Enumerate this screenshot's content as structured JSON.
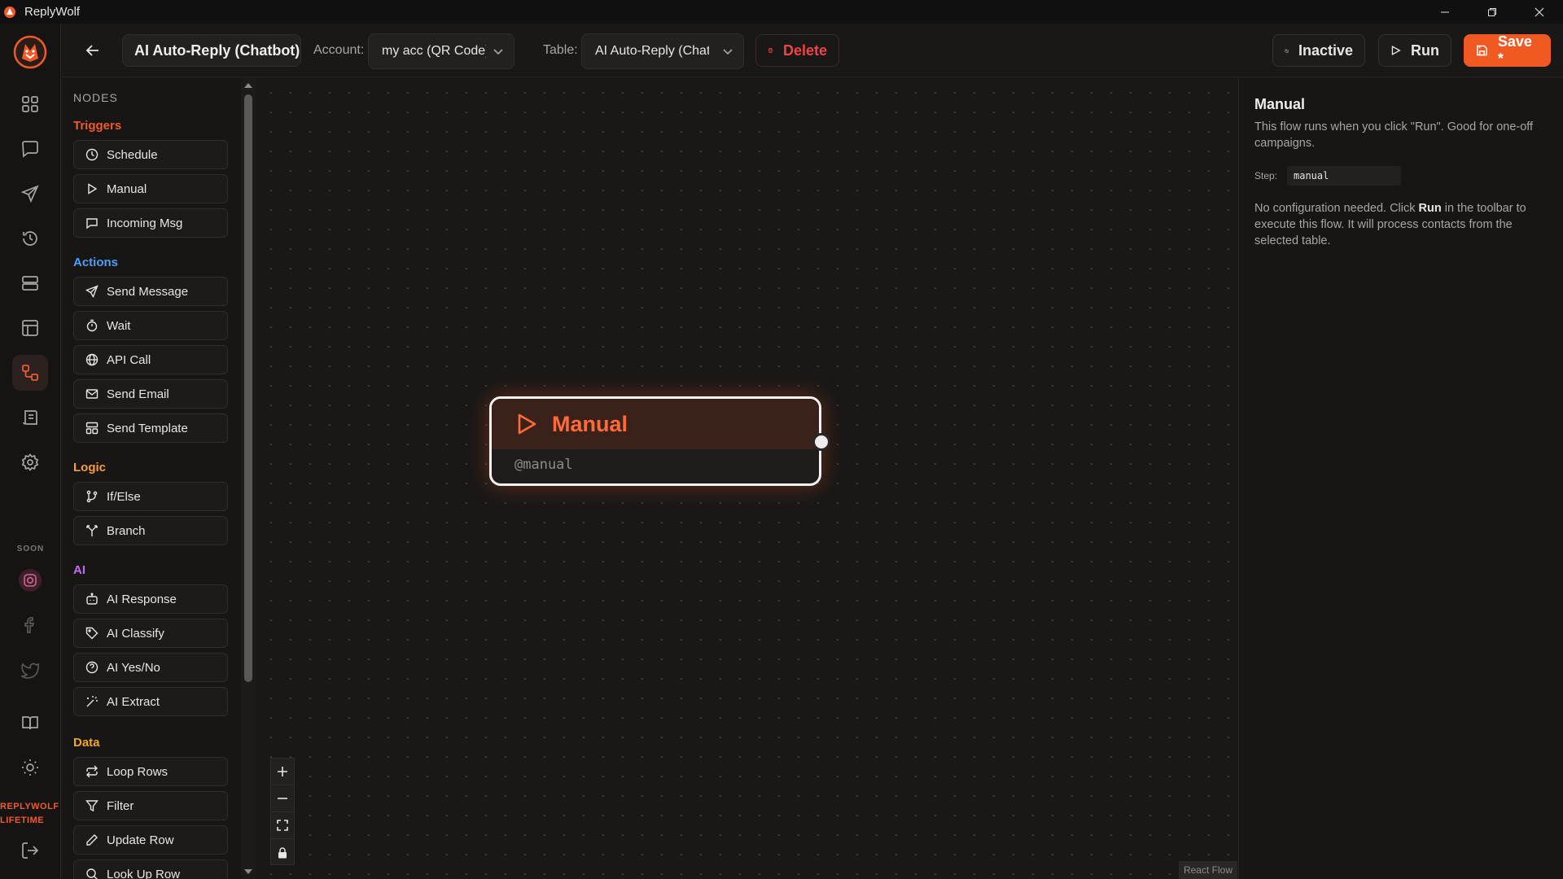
{
  "window": {
    "title": "ReplyWolf",
    "controls": [
      "minimize-icon",
      "restore-icon",
      "close-icon"
    ]
  },
  "rail": {
    "items": [
      "dashboard-icon",
      "chat-icon",
      "send-icon",
      "history-icon",
      "tables-icon",
      "layout-icon",
      "flows-icon",
      "templates-icon",
      "settings-icon"
    ],
    "active": "flows-icon",
    "soon_label": "SOON",
    "soon_items": [
      "instagram-icon",
      "facebook-icon",
      "twitter-icon"
    ],
    "bottom_items": [
      "docs-icon",
      "theme-icon",
      "logout-icon"
    ],
    "plan_line1": "REPLYWOLF",
    "plan_line2": "LIFETIME"
  },
  "toolbar": {
    "flow_name": "AI Auto-Reply (Chatbot)",
    "account_label": "Account:",
    "account_value": "my acc (QR Code)",
    "table_label": "Table:",
    "table_value": "AI Auto-Reply (Chatbot)",
    "delete_label": "Delete",
    "inactive_label": "Inactive",
    "run_label": "Run",
    "save_label": "Save *"
  },
  "palette": {
    "title": "NODES",
    "sections": {
      "triggers": {
        "label": "Triggers",
        "color": "#ef5a2a",
        "items": [
          "Schedule",
          "Manual",
          "Incoming Msg"
        ]
      },
      "actions": {
        "label": "Actions",
        "color": "#4f9df5",
        "items": [
          "Send Message",
          "Wait",
          "API Call",
          "Send Email",
          "Send Template"
        ]
      },
      "logic": {
        "label": "Logic",
        "color": "#f59e3b",
        "items": [
          "If/Else",
          "Branch"
        ]
      },
      "ai": {
        "label": "AI",
        "color": "#c06cf0",
        "items": [
          "AI Response",
          "AI Classify",
          "AI Yes/No",
          "AI Extract"
        ]
      },
      "data": {
        "label": "Data",
        "color": "#f5a623",
        "items": [
          "Loop Rows",
          "Filter",
          "Update Row",
          "Look Up Row"
        ]
      }
    }
  },
  "canvas": {
    "node_title": "Manual",
    "node_sub": "@manual",
    "attribution": "React Flow"
  },
  "inspector": {
    "title": "Manual",
    "description": "This flow runs when you click \"Run\". Good for one-off campaigns.",
    "step_label": "Step:",
    "step_value": "manual",
    "note_prefix": "No configuration needed. Click ",
    "note_bold": "Run",
    "note_suffix": " in the toolbar to execute this flow. It will process contacts from the selected table."
  }
}
